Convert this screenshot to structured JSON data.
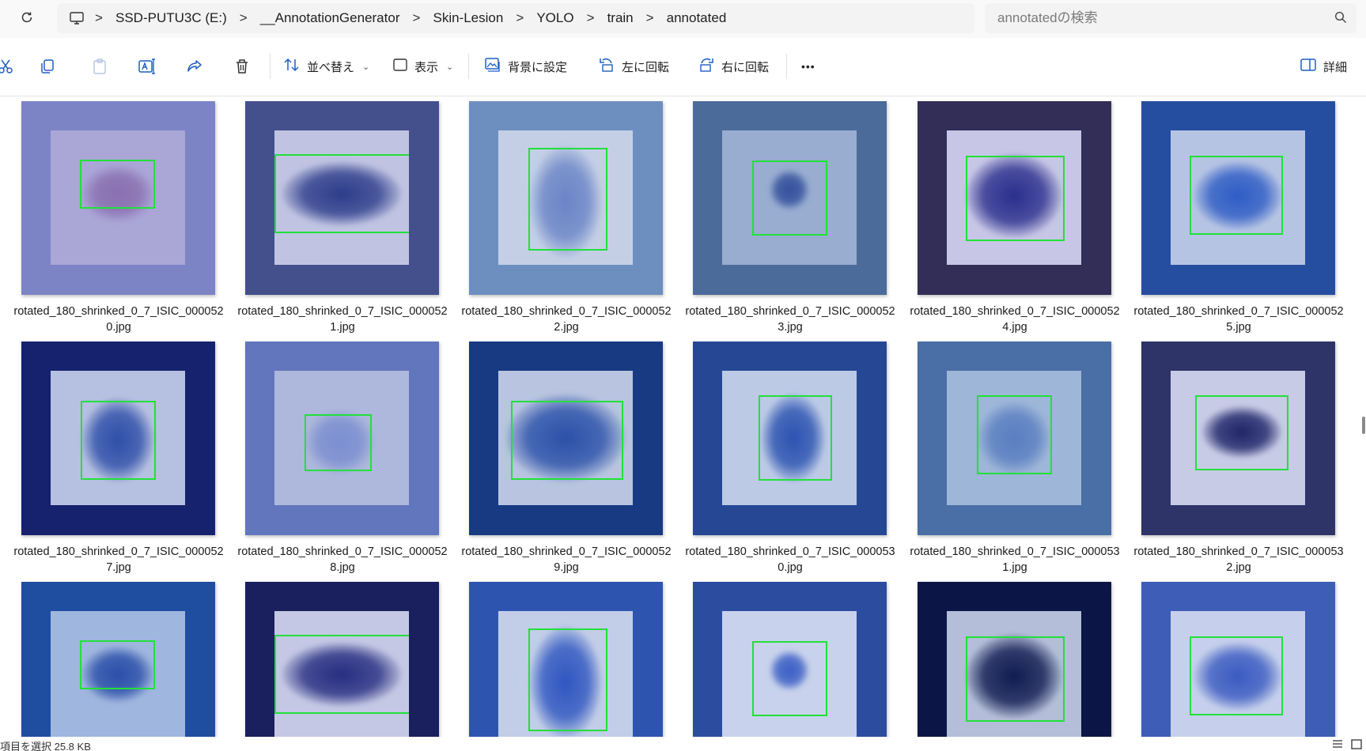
{
  "breadcrumb": {
    "items": [
      "SSD-PUTU3C (E:)",
      "__AnnotationGenerator",
      "Skin-Lesion",
      "YOLO",
      "train",
      "annotated"
    ],
    "separator": ">"
  },
  "search": {
    "placeholder": "annotatedの検索"
  },
  "toolbar": {
    "sort_label": "並べ替え",
    "view_label": "表示",
    "set_background_label": "背景に設定",
    "rotate_left_label": "左に回転",
    "rotate_right_label": "右に回転",
    "more_label": "•••",
    "details_label": "詳細"
  },
  "files": [
    {
      "name": "rotated_180_shrinked_0_7_ISIC_0000520.jpg",
      "line1": "rotated_180_shrinked_0_7_ISIC_000052",
      "line2": "0.jpg",
      "frame": "#7c84c6",
      "photo": "#aaa6d6",
      "lesion": "#8a6fb0"
    },
    {
      "name": "rotated_180_shrinked_0_7_ISIC_0000521.jpg",
      "line1": "rotated_180_shrinked_0_7_ISIC_000052",
      "line2": "1.jpg",
      "frame": "#44508c",
      "photo": "#c0c4e2",
      "lesion": "#2c3c8a"
    },
    {
      "name": "rotated_180_shrinked_0_7_ISIC_0000522.jpg",
      "line1": "rotated_180_shrinked_0_7_ISIC_000052",
      "line2": "2.jpg",
      "frame": "#6d8fc0",
      "photo": "#c4cfe6",
      "lesion": "#6a84c6"
    },
    {
      "name": "rotated_180_shrinked_0_7_ISIC_0000523.jpg",
      "line1": "rotated_180_shrinked_0_7_ISIC_000052",
      "line2": "3.jpg",
      "frame": "#4b6b9a",
      "photo": "#98add0",
      "lesion": "#34509c"
    },
    {
      "name": "rotated_180_shrinked_0_7_ISIC_0000524.jpg",
      "line1": "rotated_180_shrinked_0_7_ISIC_000052",
      "line2": "4.jpg",
      "frame": "#322e58",
      "photo": "#c8c6e6",
      "lesion": "#2a2e8c"
    },
    {
      "name": "rotated_180_shrinked_0_7_ISIC_0000525.jpg",
      "line1": "rotated_180_shrinked_0_7_ISIC_000052",
      "line2": "5.jpg",
      "frame": "#264ea0",
      "photo": "#b6c4e4",
      "lesion": "#2e5cc4"
    },
    {
      "name": "rotated_180_shrinked_0_7_ISIC_0000527.jpg",
      "line1": "rotated_180_shrinked_0_7_ISIC_000052",
      "line2": "7.jpg",
      "frame": "#16226e",
      "photo": "#b6c0e0",
      "lesion": "#2e4ea8"
    },
    {
      "name": "rotated_180_shrinked_0_7_ISIC_0000528.jpg",
      "line1": "rotated_180_shrinked_0_7_ISIC_000052",
      "line2": "8.jpg",
      "frame": "#6176bc",
      "photo": "#aeb8dc",
      "lesion": "#7b8ed0"
    },
    {
      "name": "rotated_180_shrinked_0_7_ISIC_0000529.jpg",
      "line1": "rotated_180_shrinked_0_7_ISIC_000052",
      "line2": "9.jpg",
      "frame": "#173a82",
      "photo": "#b8c4e0",
      "lesion": "#2a50a8"
    },
    {
      "name": "rotated_180_shrinked_0_7_ISIC_0000530.jpg",
      "line1": "rotated_180_shrinked_0_7_ISIC_000053",
      "line2": "0.jpg",
      "frame": "#264894",
      "photo": "#bccae6",
      "lesion": "#2a52b0"
    },
    {
      "name": "rotated_180_shrinked_0_7_ISIC_0000531.jpg",
      "line1": "rotated_180_shrinked_0_7_ISIC_000053",
      "line2": "1.jpg",
      "frame": "#4a6ea6",
      "photo": "#9eb6d8",
      "lesion": "#5a7ec0"
    },
    {
      "name": "rotated_180_shrinked_0_7_ISIC_0000532.jpg",
      "line1": "rotated_180_shrinked_0_7_ISIC_000053",
      "line2": "2.jpg",
      "frame": "#2e3468",
      "photo": "#c8cbe6",
      "lesion": "#1e2468"
    },
    {
      "name": "",
      "line1": "",
      "line2": "",
      "frame": "#1f4da0",
      "photo": "#9fb6de",
      "lesion": "#2a4ea8"
    },
    {
      "name": "",
      "line1": "",
      "line2": "",
      "frame": "#1a1f5e",
      "photo": "#c4c8e4",
      "lesion": "#262c80"
    },
    {
      "name": "",
      "line1": "",
      "line2": "",
      "frame": "#2d55b0",
      "photo": "#c2cde8",
      "lesion": "#2e56c0"
    },
    {
      "name": "",
      "line1": "",
      "line2": "",
      "frame": "#2c4ca0",
      "photo": "#c8d2ec",
      "lesion": "#3a5ec4"
    },
    {
      "name": "",
      "line1": "",
      "line2": "",
      "frame": "#0c1646",
      "photo": "#b4bed8",
      "lesion": "#101a50"
    },
    {
      "name": "",
      "line1": "",
      "line2": "",
      "frame": "#3d5db6",
      "photo": "#c6d0ec",
      "lesion": "#3a5ac0"
    }
  ],
  "status": {
    "text": "項目を選択  25.8 KB"
  },
  "colors": {
    "bbox": "#22e03a",
    "toolbar_bg": "#ffffff",
    "address_bg": "#f3f3f3"
  }
}
